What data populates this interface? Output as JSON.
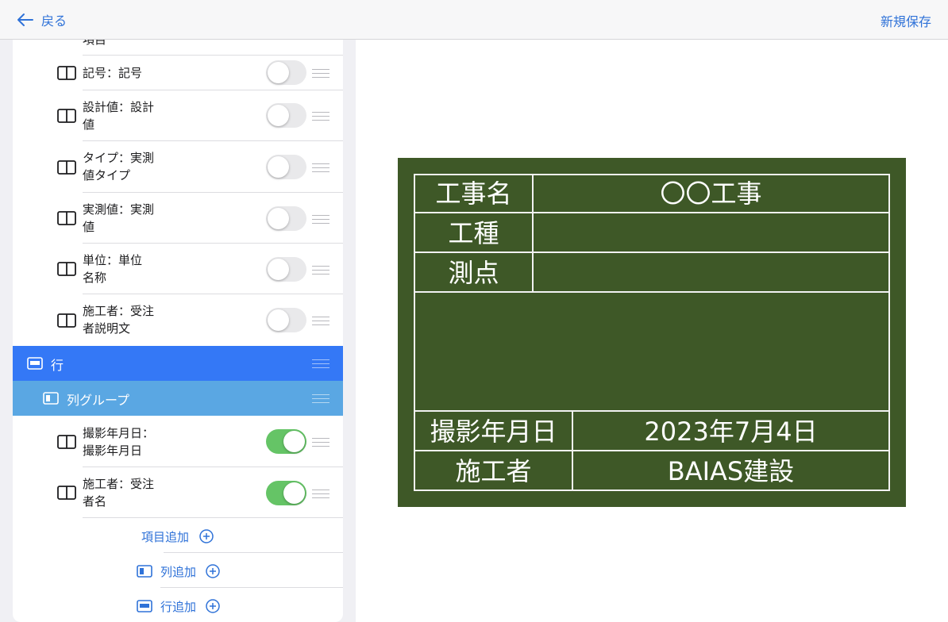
{
  "header": {
    "back_label": "戻る",
    "save_label": "新規保存"
  },
  "sidebar": {
    "top_partial_label": "項目",
    "items": [
      {
        "line1": "記号：記号",
        "line2": "",
        "on": false
      },
      {
        "line1": "設計値：設計",
        "line2": "値",
        "on": false
      },
      {
        "line1": "タイプ：実測",
        "line2": "値タイプ",
        "on": false
      },
      {
        "line1": "実測値：実測",
        "line2": "値",
        "on": false
      },
      {
        "line1": "単位：単位",
        "line2": "名称",
        "on": false
      },
      {
        "line1": "施工者：受注",
        "line2": "者説明文",
        "on": false
      }
    ],
    "row_group_label": "行",
    "column_group_label": "列グループ",
    "group_items": [
      {
        "line1": "撮影年月日：",
        "line2": "撮影年月日",
        "on": true
      },
      {
        "line1": "施工者：受注",
        "line2": "者名",
        "on": true
      }
    ],
    "add_item_label": "項目追加",
    "add_column_label": "列追加",
    "add_row_label": "行追加"
  },
  "board": {
    "background_color": "#3e5827",
    "line_color": "#f2f2f2",
    "rows": [
      {
        "label": "工事名",
        "value": "〇〇工事"
      },
      {
        "label": "工種",
        "value": ""
      },
      {
        "label": "測点",
        "value": ""
      },
      {
        "label": "撮影年月日",
        "value": "2023年7月4日"
      },
      {
        "label": "施工者",
        "value": "BAIAS建設"
      }
    ]
  },
  "colors": {
    "accent": "#2f72d8",
    "selected_row": "#3478f6",
    "selected_group": "#5aa7e3",
    "toggle_on": "#65c466",
    "toggle_off": "#e9e9eb"
  }
}
